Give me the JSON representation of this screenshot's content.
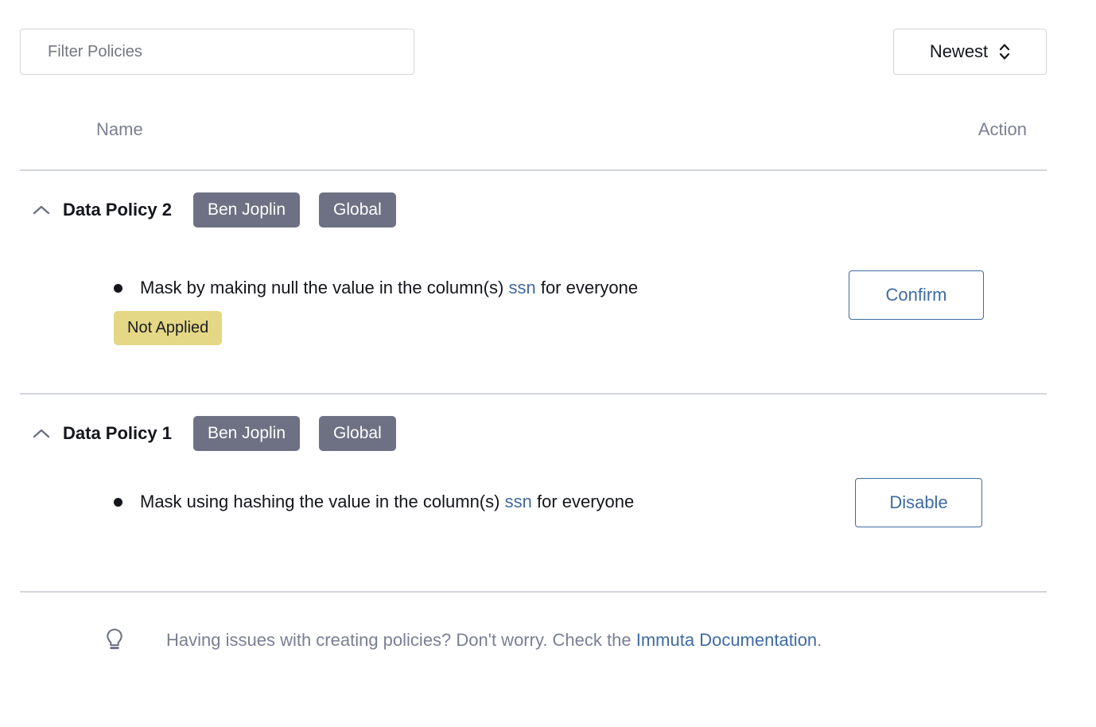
{
  "toolbar": {
    "filter_placeholder": "Filter Policies",
    "filter_value": "",
    "sort_label": "Newest",
    "sort_icon": "chevron-up-down-icon"
  },
  "table": {
    "columns": {
      "name": "Name",
      "action": "Action"
    }
  },
  "policies": [
    {
      "id": "data-policy-2",
      "toggle_icon": "chevron-up-icon",
      "title": "Data Policy 2",
      "badges": [
        "Ben Joplin",
        "Global"
      ],
      "rule": {
        "prefix": "Mask by making null the value in the column(s)",
        "column": "ssn",
        "suffix": "for everyone"
      },
      "status": "Not Applied",
      "has_status": true,
      "action_label": "Confirm"
    },
    {
      "id": "data-policy-1",
      "toggle_icon": "chevron-up-icon",
      "title": "Data Policy 1",
      "badges": [
        "Ben Joplin",
        "Global"
      ],
      "rule": {
        "prefix": "Mask using hashing the value in the column(s)",
        "column": "ssn",
        "suffix": "for everyone"
      },
      "status": "",
      "has_status": false,
      "action_label": "Disable"
    }
  ],
  "footer": {
    "icon": "lightbulb-icon",
    "text_before": "Having issues with creating policies? Don't worry. Check the",
    "link_text": "Immuta Documentation",
    "text_after": "."
  },
  "colors": {
    "badge_bg": "#6d7183",
    "status_bg": "#e4d785",
    "link_blue": "#3d6ba4",
    "column_blue": "#41699f",
    "muted_text": "#7a7f93",
    "divider": "#d3d5dc",
    "border": "#d4d6dc"
  }
}
